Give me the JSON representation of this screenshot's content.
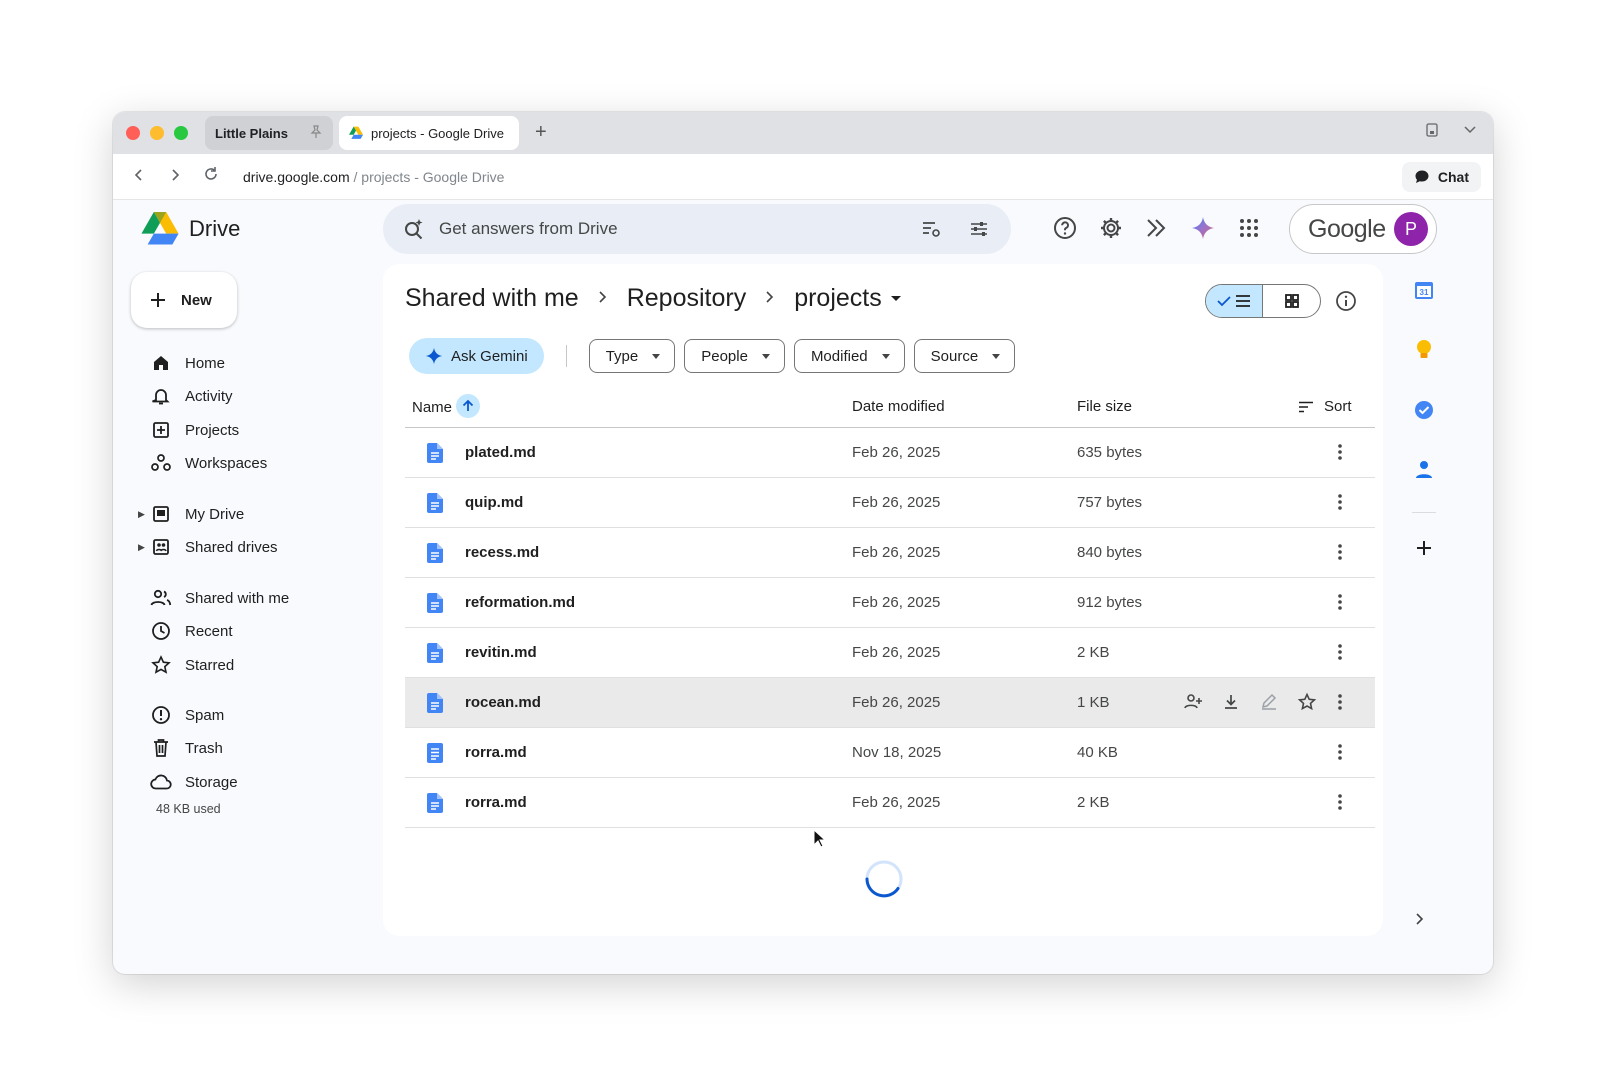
{
  "browser": {
    "tabs": [
      {
        "label": "Little Plains",
        "active": false
      },
      {
        "label": "projects - Google Drive",
        "active": true
      }
    ],
    "url_host": "drive.google.com",
    "url_rest": " / projects - Google Drive",
    "chat_label": "Chat"
  },
  "header": {
    "app_name": "Drive",
    "search_placeholder": "Get answers from Drive",
    "account_brand": "Google",
    "avatar_letter": "P"
  },
  "sidebar": {
    "new_label": "New",
    "items": [
      {
        "label": "Home",
        "icon": "home-icon"
      },
      {
        "label": "Activity",
        "icon": "bell-icon"
      },
      {
        "label": "Projects",
        "icon": "projects-icon"
      },
      {
        "label": "Workspaces",
        "icon": "workspaces-icon"
      },
      {
        "label": "My Drive",
        "icon": "my-drive-icon"
      },
      {
        "label": "Shared drives",
        "icon": "shared-drives-icon"
      },
      {
        "label": "Shared with me",
        "icon": "people-icon"
      },
      {
        "label": "Recent",
        "icon": "clock-icon"
      },
      {
        "label": "Starred",
        "icon": "star-icon"
      },
      {
        "label": "Spam",
        "icon": "spam-icon"
      },
      {
        "label": "Trash",
        "icon": "trash-icon"
      },
      {
        "label": "Storage",
        "icon": "cloud-icon"
      }
    ],
    "storage_used": "48 KB used"
  },
  "main": {
    "breadcrumb": [
      "Shared with me",
      "Repository",
      "projects"
    ],
    "ask_gemini_label": "Ask Gemini",
    "filters": [
      "Type",
      "People",
      "Modified",
      "Source"
    ],
    "columns": {
      "name": "Name",
      "date": "Date modified",
      "size": "File size",
      "sort": "Sort"
    },
    "files": [
      {
        "name": "plated.md",
        "date": "Feb 26, 2025",
        "size": "635 bytes"
      },
      {
        "name": "quip.md",
        "date": "Feb 26, 2025",
        "size": "757 bytes"
      },
      {
        "name": "recess.md",
        "date": "Feb 26, 2025",
        "size": "840 bytes"
      },
      {
        "name": "reformation.md",
        "date": "Feb 26, 2025",
        "size": "912 bytes"
      },
      {
        "name": "revitin.md",
        "date": "Feb 26, 2025",
        "size": "2 KB"
      },
      {
        "name": "rocean.md",
        "date": "Feb 26, 2025",
        "size": "1 KB"
      },
      {
        "name": "rorra.md",
        "date": "Nov 18, 2025",
        "size": "40 KB"
      },
      {
        "name": "rorra.md",
        "date": "Feb 26, 2025",
        "size": "2 KB"
      }
    ]
  },
  "colors": {
    "accent": "#0b57d0",
    "selected_chip": "#c2e7ff",
    "doc_icon": "#4285f4"
  }
}
